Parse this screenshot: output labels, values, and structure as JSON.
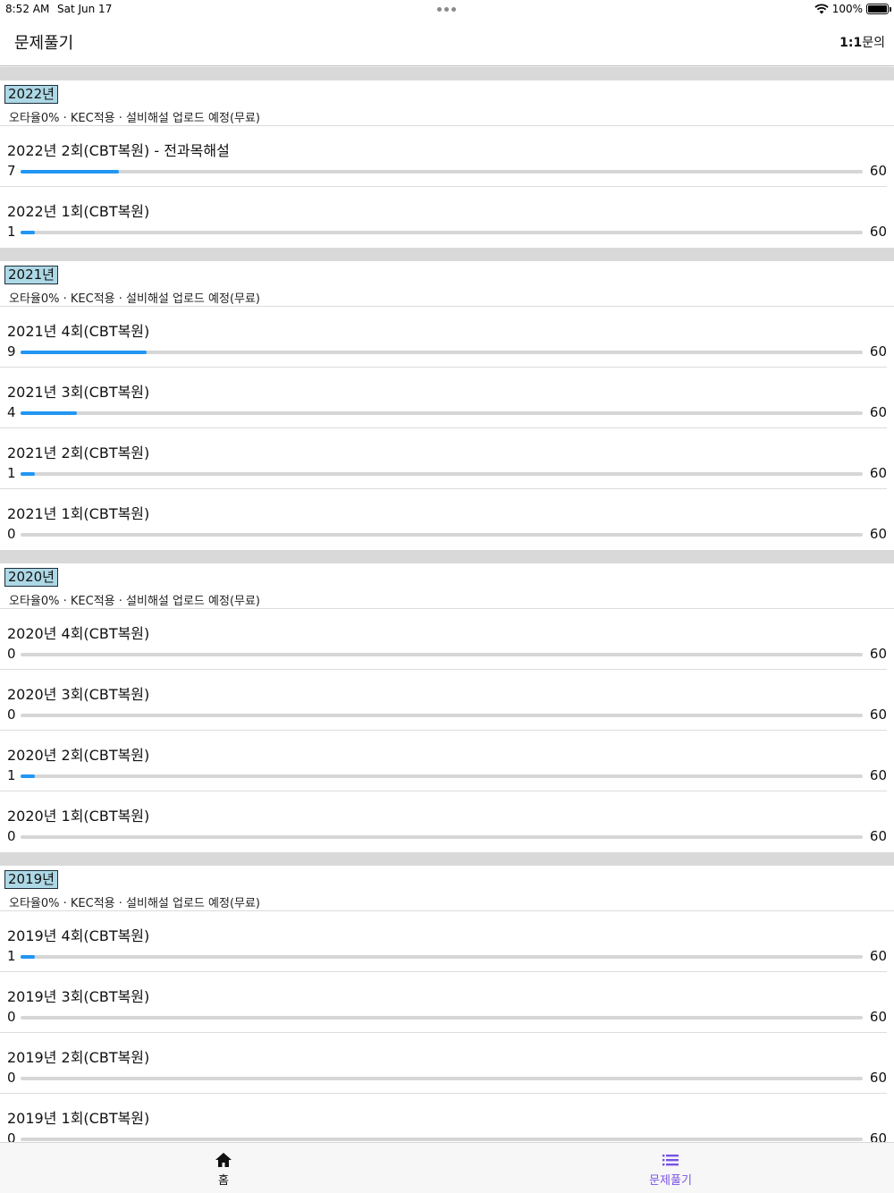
{
  "status": {
    "time": "8:52 AM",
    "date": "Sat Jun 17",
    "battery": "100%"
  },
  "header": {
    "title": "문제풀기",
    "inquiry_bold": "1:1",
    "inquiry_rest": "문의"
  },
  "sections": [
    {
      "year": "2022년",
      "desc": "오타율0% · KEC적용 · 설비해설 업로드 예정(무료)",
      "items": [
        {
          "title": "2022년 2회(CBT복원) - 전과목해설",
          "count": "7",
          "total": "60",
          "progress": 0.117
        },
        {
          "title": "2022년 1회(CBT복원)",
          "count": "1",
          "total": "60",
          "progress": 0.017
        }
      ]
    },
    {
      "year": "2021년",
      "desc": "오타율0% · KEC적용 · 설비해설 업로드 예정(무료)",
      "items": [
        {
          "title": "2021년 4회(CBT복원)",
          "count": "9",
          "total": "60",
          "progress": 0.15
        },
        {
          "title": "2021년 3회(CBT복원)",
          "count": "4",
          "total": "60",
          "progress": 0.067
        },
        {
          "title": "2021년 2회(CBT복원)",
          "count": "1",
          "total": "60",
          "progress": 0.017
        },
        {
          "title": "2021년 1회(CBT복원)",
          "count": "0",
          "total": "60",
          "progress": 0
        }
      ]
    },
    {
      "year": "2020년",
      "desc": "오타율0% · KEC적용 · 설비해설 업로드 예정(무료)",
      "items": [
        {
          "title": "2020년 4회(CBT복원)",
          "count": "0",
          "total": "60",
          "progress": 0
        },
        {
          "title": "2020년 3회(CBT복원)",
          "count": "0",
          "total": "60",
          "progress": 0
        },
        {
          "title": "2020년 2회(CBT복원)",
          "count": "1",
          "total": "60",
          "progress": 0.017
        },
        {
          "title": "2020년 1회(CBT복원)",
          "count": "0",
          "total": "60",
          "progress": 0
        }
      ]
    },
    {
      "year": "2019년",
      "desc": "오타율0% · KEC적용 · 설비해설 업로드 예정(무료)",
      "items": [
        {
          "title": "2019년 4회(CBT복원)",
          "count": "1",
          "total": "60",
          "progress": 0.017
        },
        {
          "title": "2019년 3회(CBT복원)",
          "count": "0",
          "total": "60",
          "progress": 0
        },
        {
          "title": "2019년 2회(CBT복원)",
          "count": "0",
          "total": "60",
          "progress": 0
        },
        {
          "title": "2019년 1회(CBT복원)",
          "count": "0",
          "total": "60",
          "progress": 0
        }
      ]
    }
  ],
  "tabs": {
    "home": {
      "label": "홈",
      "icon": "home-icon"
    },
    "solve": {
      "label": "문제풀기",
      "icon": "list-icon"
    }
  },
  "colors": {
    "accent": "#2196f3",
    "active_tab": "#7a52e8",
    "year_badge": "#add8e6",
    "section_gap": "#d9d9d9"
  }
}
